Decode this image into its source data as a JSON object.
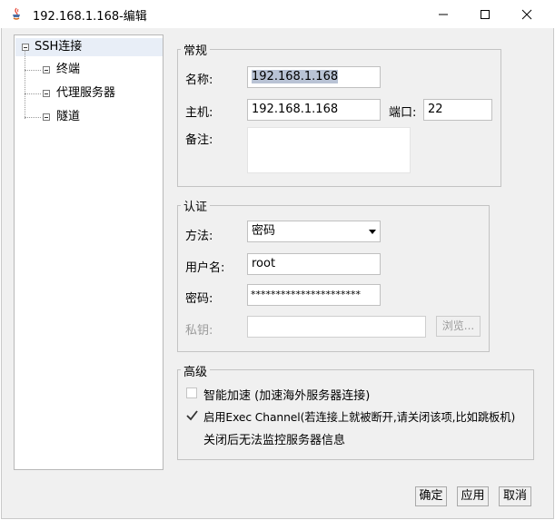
{
  "window": {
    "title": "192.168.1.168-编辑",
    "minimize_icon": "minimize-icon",
    "maximize_icon": "maximize-icon",
    "close_icon": "close-icon"
  },
  "tree": {
    "root": "SSH连接",
    "children": [
      "终端",
      "代理服务器",
      "隧道"
    ]
  },
  "general": {
    "title": "常规",
    "name_label": "名称:",
    "name_value": "192.168.1.168",
    "host_label": "主机:",
    "host_value": "192.168.1.168",
    "port_label": "端口:",
    "port_value": "22",
    "note_label": "备注:",
    "note_value": ""
  },
  "auth": {
    "title": "认证",
    "method_label": "方法:",
    "method_value": "密码",
    "username_label": "用户名:",
    "username_value": "root",
    "password_label": "密码:",
    "password_value": "**********************",
    "key_label": "私钥:",
    "key_value": "",
    "browse_label": "浏览..."
  },
  "advanced": {
    "title": "高级",
    "smart_accel_label": "智能加速 (加速海外服务器连接)",
    "smart_accel_checked": false,
    "exec_channel_label": "启用Exec Channel(若连接上就被断开,请关闭该项,比如跳板机)",
    "exec_channel_checked": true,
    "exec_channel_note": "关闭后无法监控服务器信息"
  },
  "buttons": {
    "ok": "确定",
    "apply": "应用",
    "cancel": "取消"
  }
}
